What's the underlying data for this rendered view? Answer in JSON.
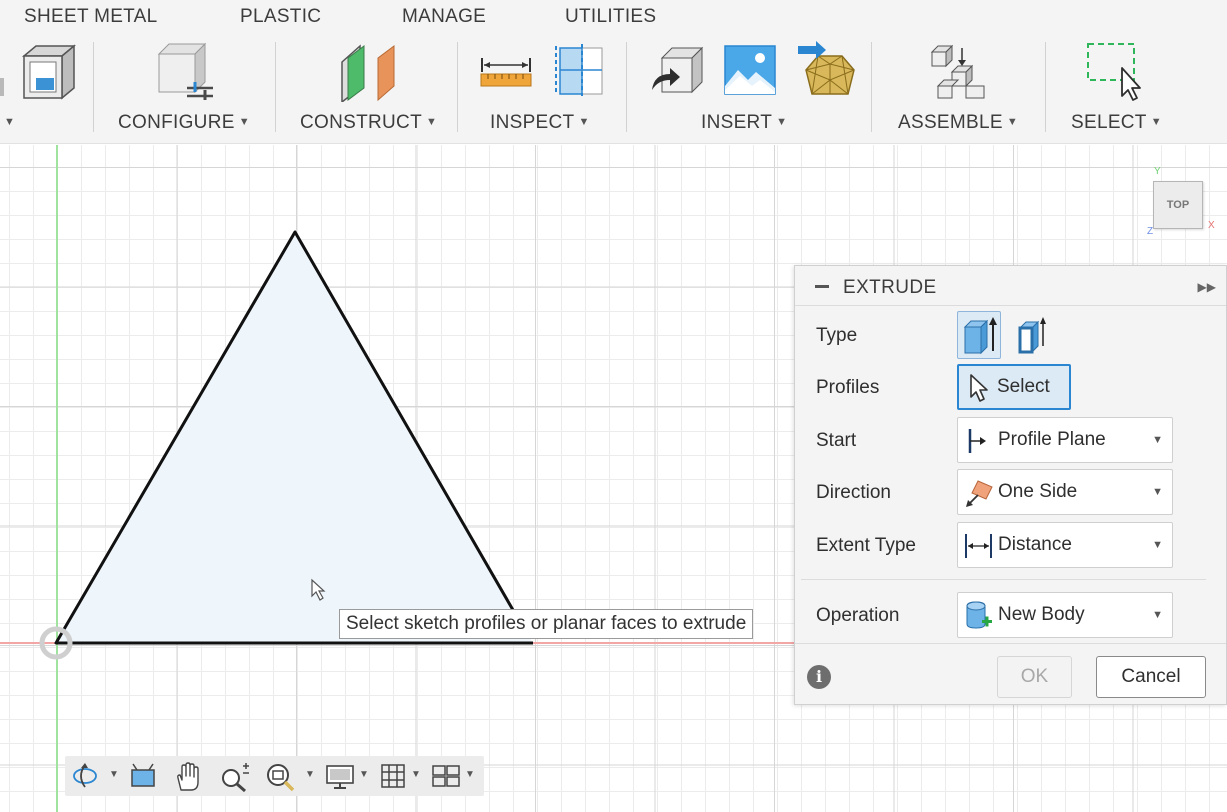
{
  "tabs": [
    "SHEET METAL",
    "PLASTIC",
    "MANAGE",
    "UTILITIES"
  ],
  "toolbar": {
    "groups": [
      {
        "label": "CONFIGURE",
        "icon": "configure-icon"
      },
      {
        "label": "CONSTRUCT",
        "icon": "construct-plane-icon"
      },
      {
        "label": "INSPECT",
        "icon": "measure-icon"
      },
      {
        "label": "INSERT",
        "icon": "insert-image-icon"
      },
      {
        "label": "ASSEMBLE",
        "icon": "joint-icon"
      },
      {
        "label": "SELECT",
        "icon": "select-window-icon"
      }
    ]
  },
  "viewcube": {
    "face": "TOP",
    "axes": {
      "x": "X",
      "y": "Y",
      "z": "Z"
    }
  },
  "tooltip": "Select sketch profiles or planar faces to extrude",
  "extrude": {
    "title": "EXTRUDE",
    "rows": {
      "type": {
        "label": "Type"
      },
      "profiles": {
        "label": "Profiles",
        "button": "Select"
      },
      "start": {
        "label": "Start",
        "value": "Profile Plane"
      },
      "direction": {
        "label": "Direction",
        "value": "One Side"
      },
      "extent": {
        "label": "Extent Type",
        "value": "Distance"
      },
      "operation": {
        "label": "Operation",
        "value": "New Body"
      }
    },
    "info": "i",
    "ok": "OK",
    "cancel": "Cancel"
  },
  "colors": {
    "accent": "#2a86d1",
    "profile_fill": "#eef5fb",
    "x_axis": "#f2a6a6",
    "y_axis": "#9fe39f"
  }
}
